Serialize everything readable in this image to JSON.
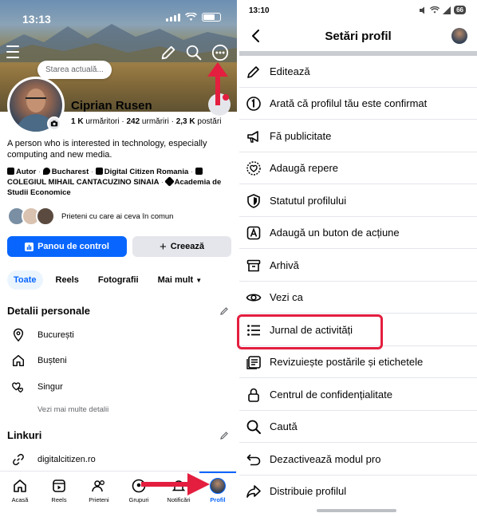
{
  "left": {
    "status": {
      "time": "13:13"
    },
    "status_bubble": "Starea actuală...",
    "profile": {
      "name": "Ciprian Rusen",
      "followers_count": "1 K",
      "followers_label": " urmăritori · ",
      "following_count": "242",
      "following_label": " urmăriri · ",
      "posts_count": "2,3 K",
      "posts_label": " postări"
    },
    "bio": "A person who is interested in technology, especially computing and new media.",
    "details": {
      "role": "Autor",
      "city": "Bucharest",
      "company": "Digital Citizen Romania",
      "school1": "COLEGIUL MIHAIL CANTACUZINO SINAIA",
      "school2": "Academia de Studii Economice"
    },
    "friends_text": "Prieteni cu care ai ceva în comun",
    "buttons": {
      "dashboard": "Panou de control",
      "create": "Creează"
    },
    "tabs": [
      "Toate",
      "Reels",
      "Fotografii",
      "Mai mult"
    ],
    "personal_details": {
      "title": "Detalii personale",
      "items": [
        "București",
        "Bușteni",
        "Singur"
      ],
      "more": "Vezi mai multe detalii"
    },
    "links": {
      "title": "Linkuri",
      "items": [
        "digitalcitizen.ro"
      ]
    },
    "nav": [
      "Acasă",
      "Reels",
      "Prieteni",
      "Grupuri",
      "Notificări",
      "Profil"
    ]
  },
  "right": {
    "status": {
      "time": "13:10",
      "battery": "66"
    },
    "title": "Setări profil",
    "menu": [
      "Editează",
      "Arată că profilul tău este confirmat",
      "Fă publicitate",
      "Adaugă repere",
      "Statutul profilului",
      "Adaugă un buton de acțiune",
      "Arhivă",
      "Vezi ca",
      "Jurnal de activități",
      "Revizuiește postările și etichetele",
      "Centrul de confidențialitate",
      "Caută",
      "Dezactivează modul pro",
      "Distribuie profilul"
    ]
  },
  "colors": {
    "accent": "#0866ff",
    "annotation": "#e41e3f"
  }
}
